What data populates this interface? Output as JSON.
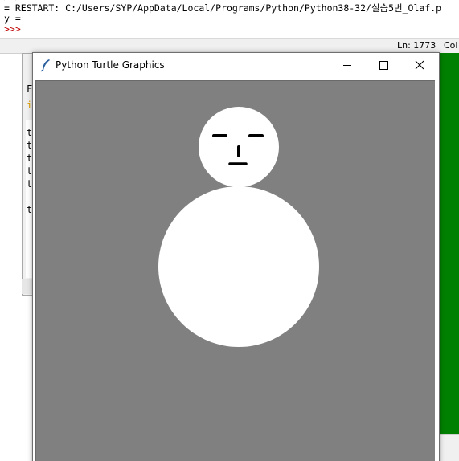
{
  "idle": {
    "lines": [
      ">>>",
      "= RESTART: C:/Users/SYP/AppData/Local/Programs/Python/Python38-32/실습5번_Olaf.p",
      "y =",
      ">>>"
    ],
    "status_line": "Ln: 1773",
    "status_col": "Col"
  },
  "editor_fragments": [
    "F",
    "i",
    "t",
    "t",
    "t",
    "t",
    "t",
    "t"
  ],
  "turtle_window": {
    "title": "Python Turtle Graphics",
    "canvas_color": "#808080",
    "snowman_color": "#ffffff",
    "feature_color": "#000000"
  },
  "colors": {
    "green_panel": "#008000",
    "prompt": "#c00000"
  },
  "icons": {
    "app": "feather-icon",
    "minimize": "minimize-icon",
    "maximize": "maximize-icon",
    "close": "close-icon"
  }
}
